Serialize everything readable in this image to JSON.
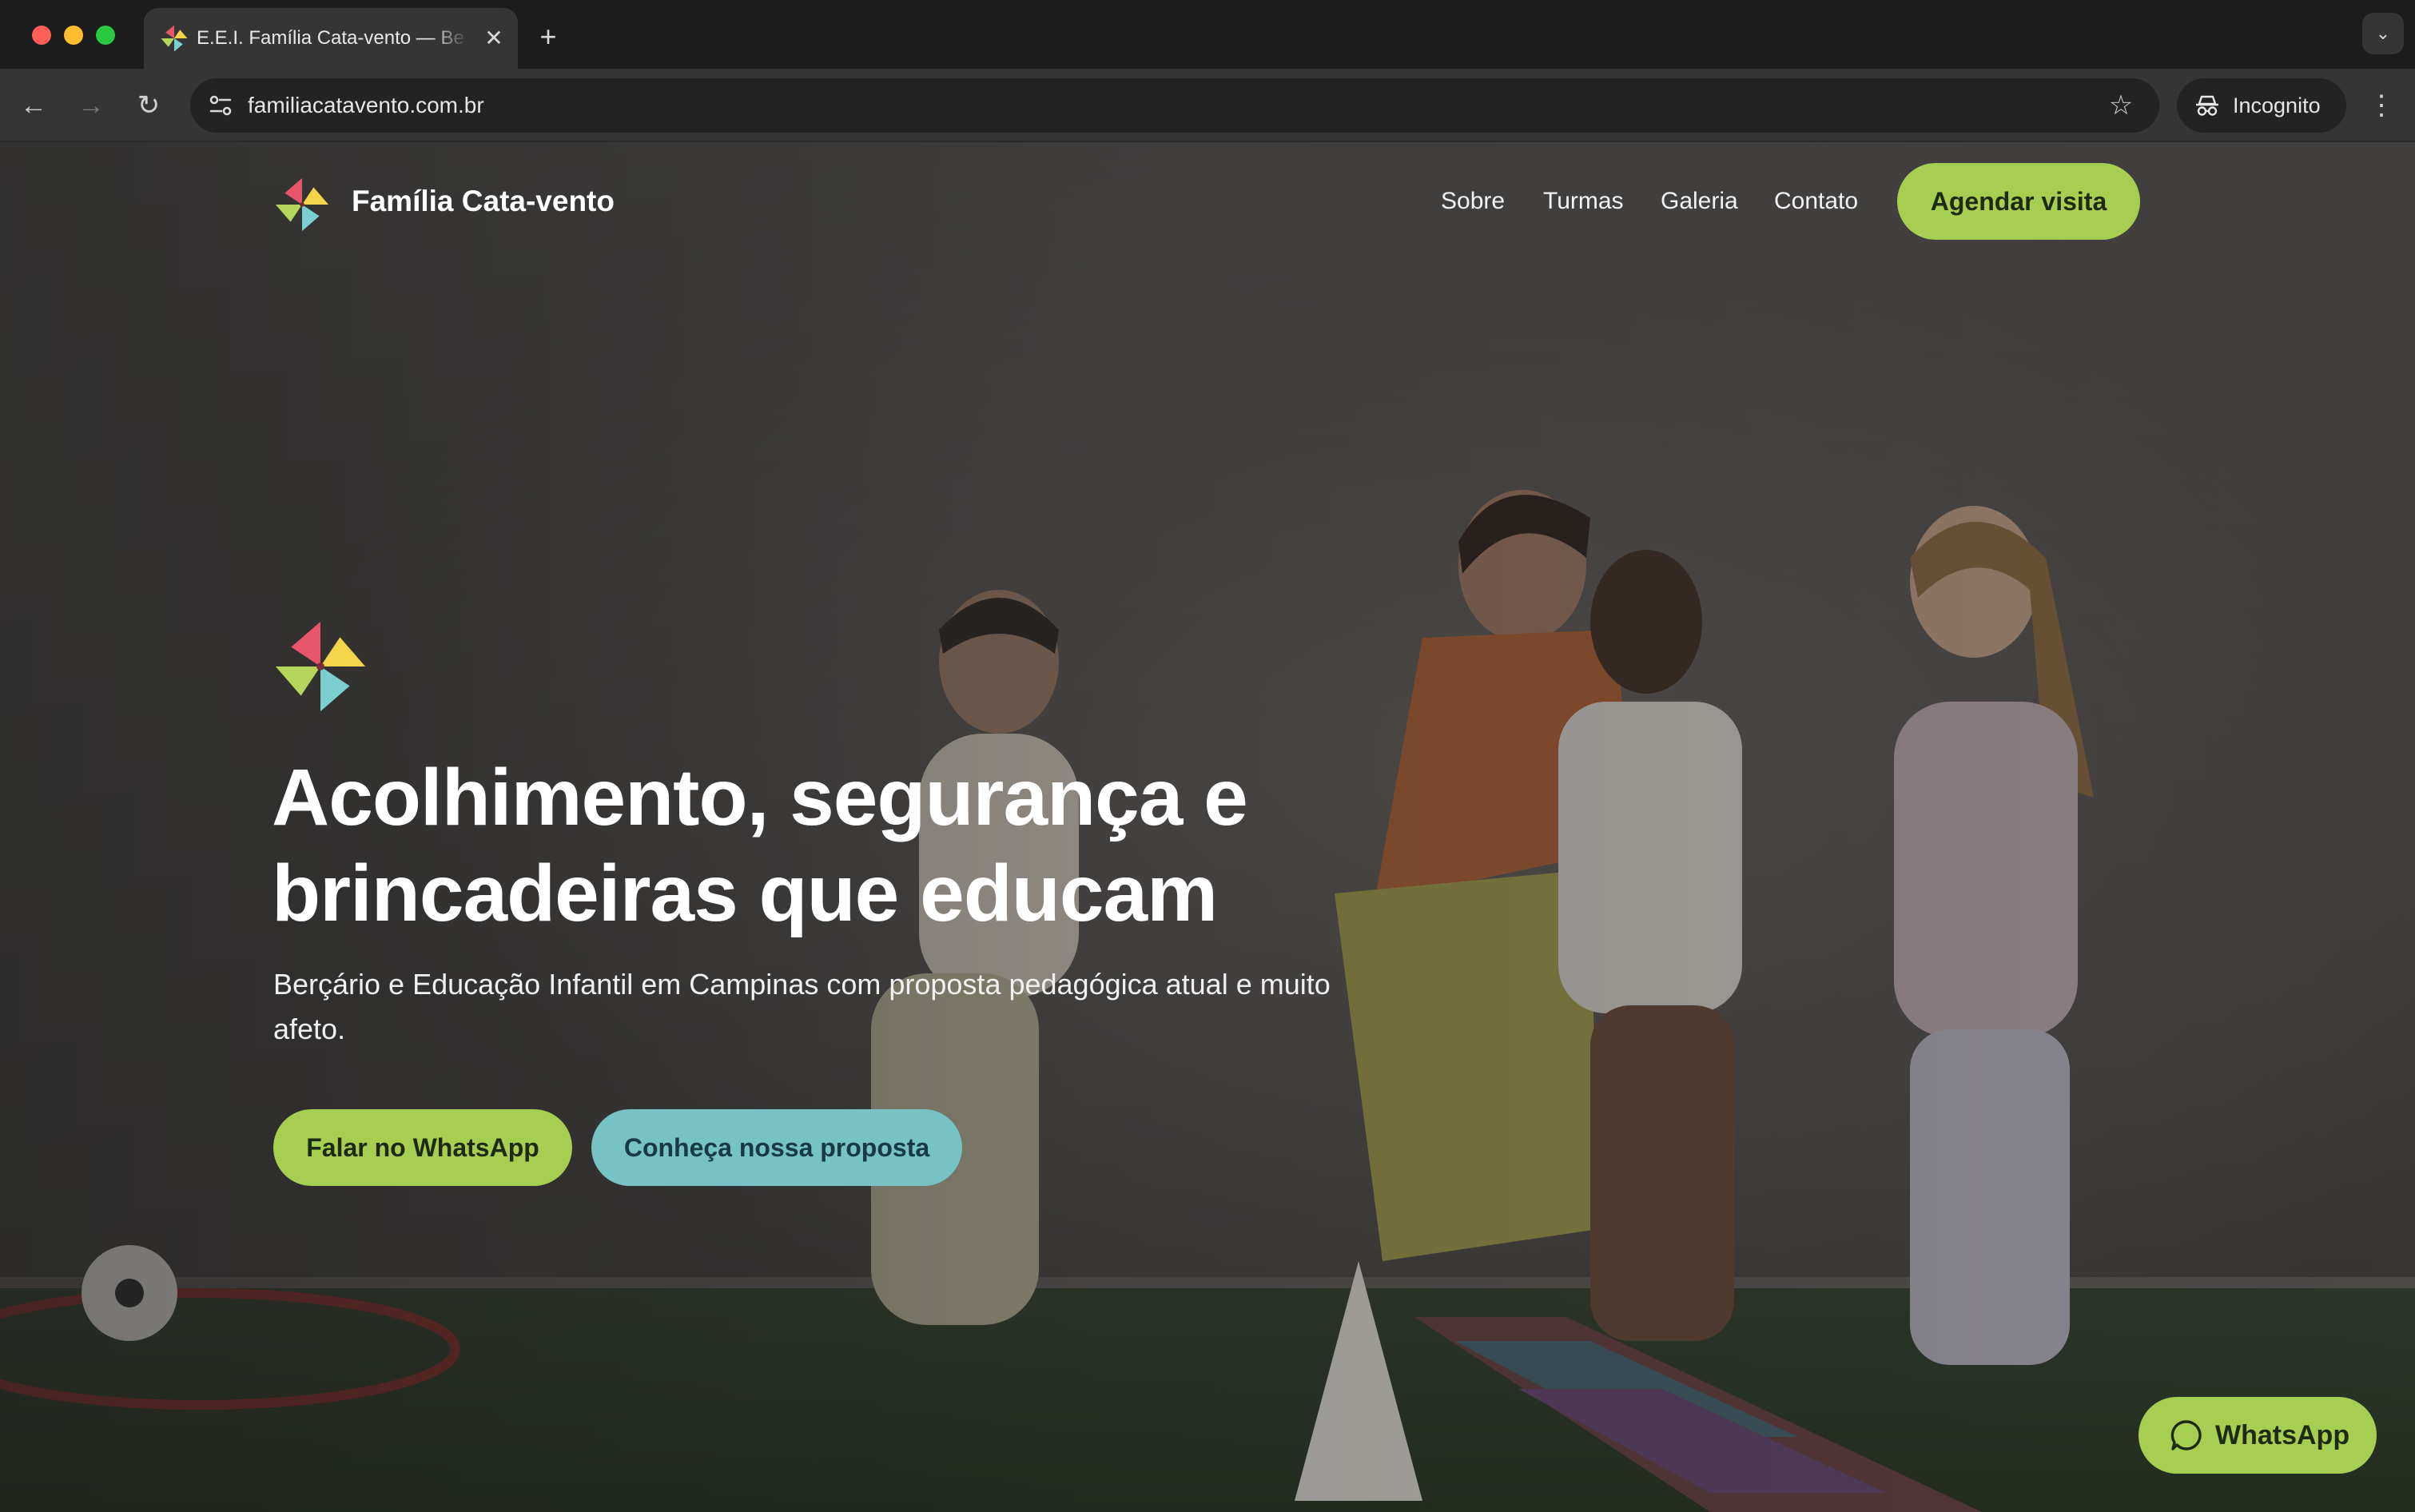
{
  "browser": {
    "tab_title": "E.E.I. Família Cata-vento — Be",
    "tab_close_glyph": "✕",
    "new_tab_glyph": "+",
    "url": "familiacatavento.com.br",
    "incognito_label": "Incognito",
    "icons": [
      "back-icon",
      "forward-icon",
      "reload-icon",
      "site-info-icon",
      "star-icon",
      "incognito-icon",
      "menu-icon",
      "tab-search-icon"
    ]
  },
  "site": {
    "brand": "Família Cata-vento",
    "nav": {
      "sobre": "Sobre",
      "turmas": "Turmas",
      "galeria": "Galeria",
      "contato": "Contato"
    },
    "cta_agendar": "Agendar visita"
  },
  "hero": {
    "title": "Acolhimento, segurança e brincadeiras que educam",
    "subtitle": "Berçário e Educação Infantil em Campinas com proposta pedagógica atual e muito afeto.",
    "primary_button": "Falar no WhatsApp",
    "secondary_button": "Conheça nossa proposta"
  },
  "floating_whatsapp": {
    "label": "WhatsApp"
  },
  "colors": {
    "accent_green": "#a6cf52",
    "accent_teal": "#76c2c4",
    "pinwheel_red": "#e8556a",
    "pinwheel_yellow": "#f3d54a",
    "pinwheel_teal": "#7ccfd0",
    "pinwheel_green": "#b5d65a"
  }
}
